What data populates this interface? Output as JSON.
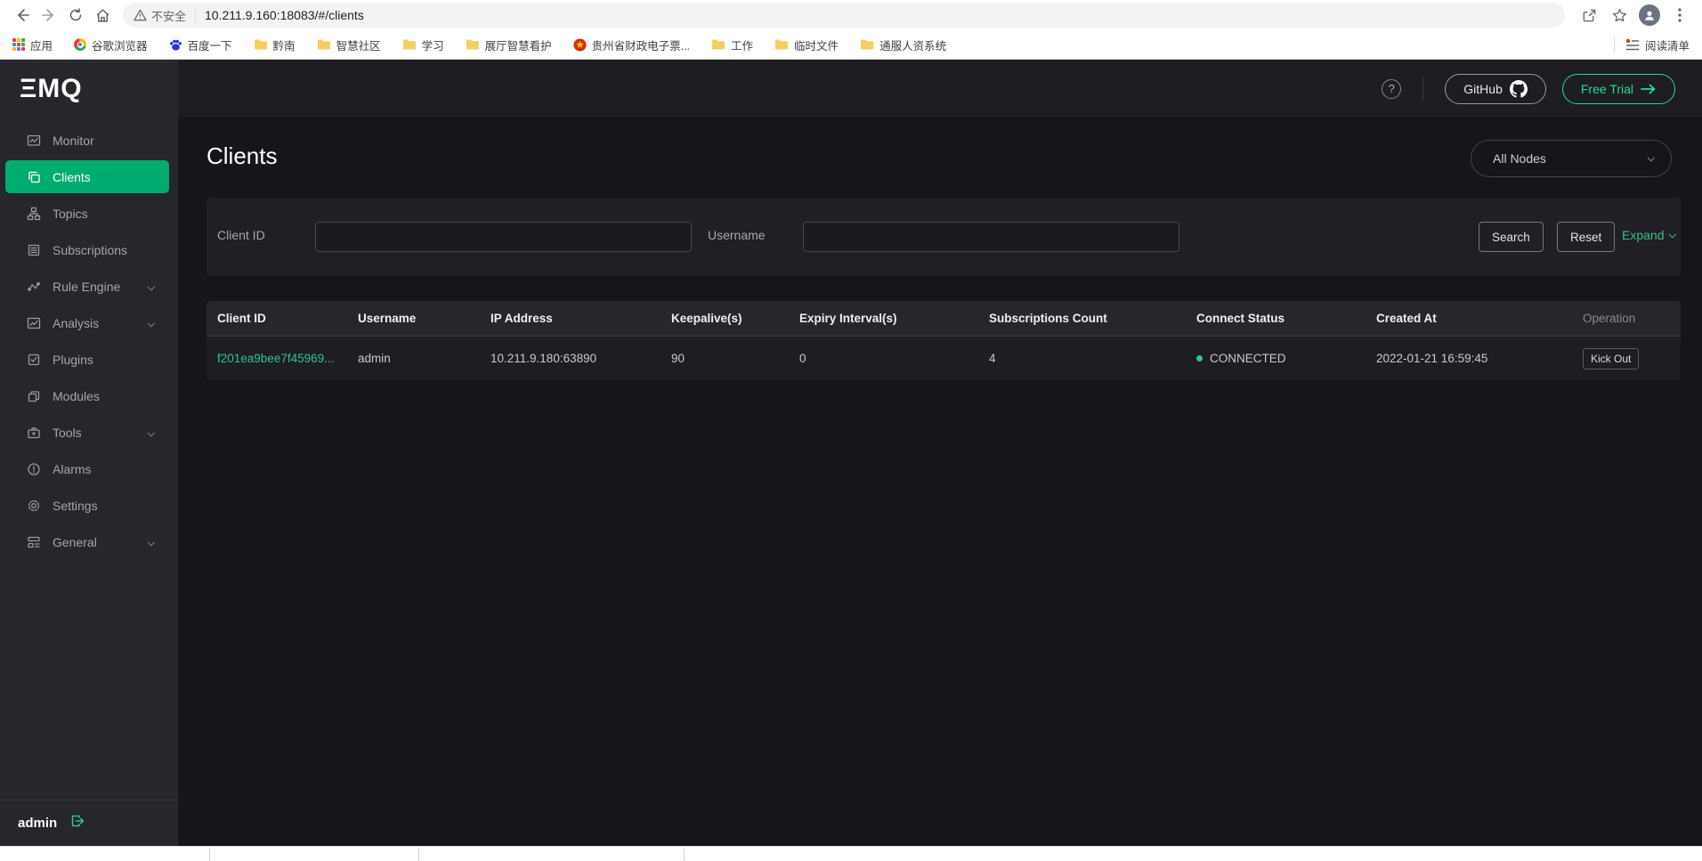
{
  "browser": {
    "security_label": "不安全",
    "url": "10.211.9.160:18083/#/clients",
    "bookmarks": [
      {
        "icon": "apps-grid",
        "label": "应用"
      },
      {
        "icon": "chrome",
        "label": "谷歌浏览器"
      },
      {
        "icon": "baidu-paw",
        "label": "百度一下"
      },
      {
        "icon": "folder",
        "label": "黔南"
      },
      {
        "icon": "folder",
        "label": "智慧社区"
      },
      {
        "icon": "folder",
        "label": "学习"
      },
      {
        "icon": "folder",
        "label": "展厅智慧看护"
      },
      {
        "icon": "emblem",
        "label": "贵州省财政电子票..."
      },
      {
        "icon": "folder",
        "label": "工作"
      },
      {
        "icon": "folder",
        "label": "临时文件"
      },
      {
        "icon": "folder",
        "label": "通服人资系统"
      }
    ],
    "reading_list_label": "阅读清单"
  },
  "app_header": {
    "github_label": "GitHub",
    "free_trial_label": "Free Trial"
  },
  "sidebar": {
    "logo_text": "ΞMQ",
    "items": [
      {
        "label": "Monitor"
      },
      {
        "label": "Clients",
        "active": true
      },
      {
        "label": "Topics"
      },
      {
        "label": "Subscriptions"
      },
      {
        "label": "Rule Engine",
        "chevron": true
      },
      {
        "label": "Analysis",
        "chevron": true
      },
      {
        "label": "Plugins"
      },
      {
        "label": "Modules"
      },
      {
        "label": "Tools",
        "chevron": true
      },
      {
        "label": "Alarms"
      },
      {
        "label": "Settings"
      },
      {
        "label": "General",
        "chevron": true
      }
    ],
    "username": "admin"
  },
  "clients_page": {
    "title": "Clients",
    "node_filter_value": "All Nodes",
    "client_id_label": "Client ID",
    "client_id_value": "",
    "username_label": "Username",
    "username_value": "",
    "search_label": "Search",
    "reset_label": "Reset",
    "expand_label": "Expand"
  },
  "table": {
    "columns": [
      "Client ID",
      "Username",
      "IP Address",
      "Keepalive(s)",
      "Expiry Interval(s)",
      "Subscriptions Count",
      "Connect Status",
      "Created At",
      "Operation"
    ],
    "row": {
      "client_id": "f201ea9bee7f45969...",
      "username": "admin",
      "ip_address": "10.211.9.180:63890",
      "keepalive": "90",
      "expiry_interval": "0",
      "subscriptions_count": "4",
      "connect_status": "CONNECTED",
      "created_at": "2022-01-21 16:59:45",
      "operation_label": "Kick Out"
    }
  },
  "colors": {
    "accent_green": "#00ac70",
    "link_green": "#34c388",
    "trial_green": "#2bd993"
  }
}
